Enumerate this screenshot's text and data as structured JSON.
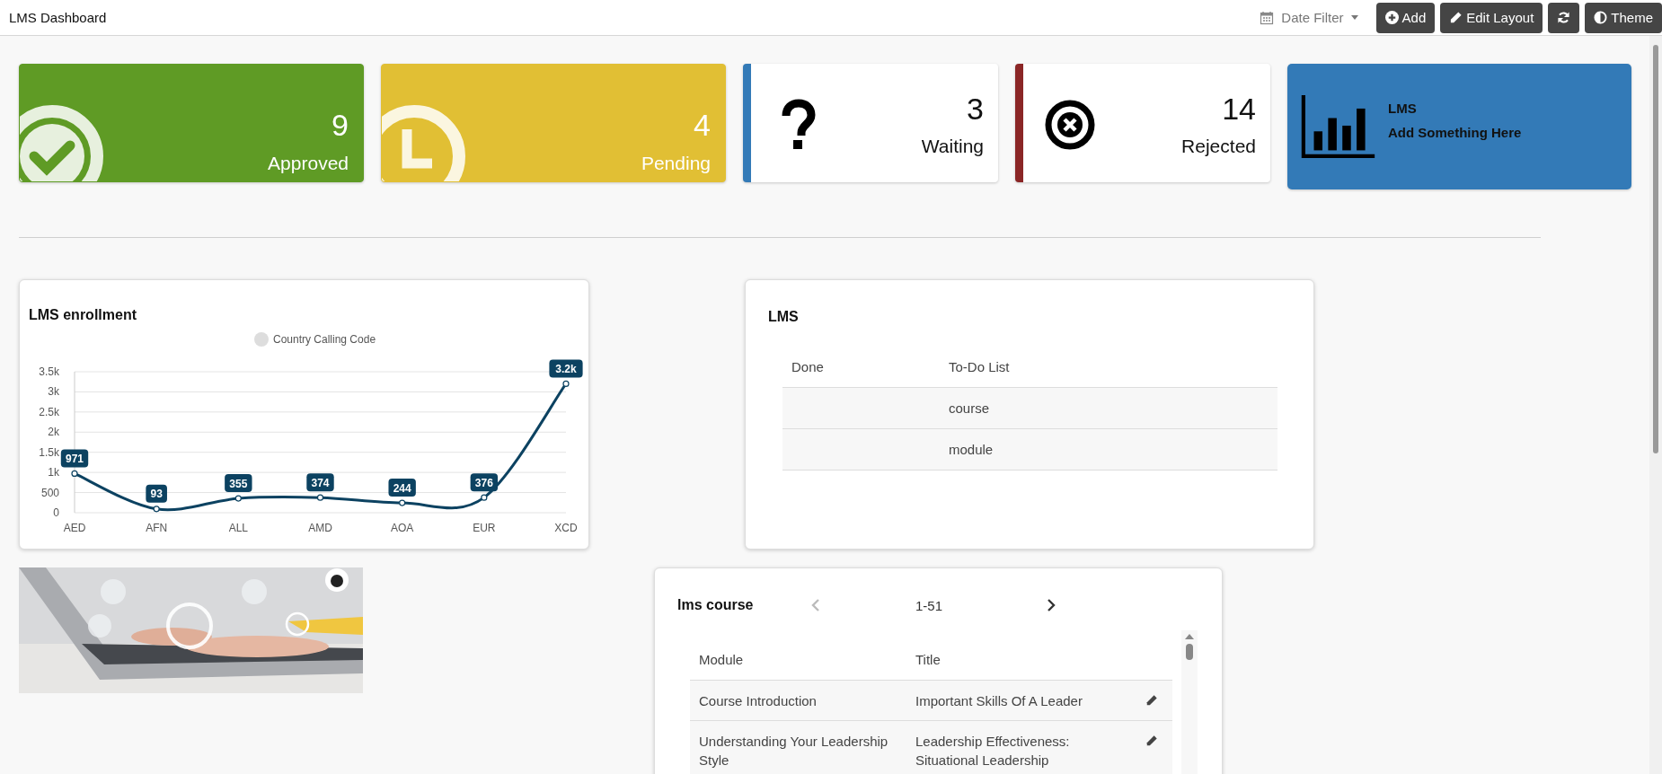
{
  "header": {
    "title": "LMS Dashboard",
    "date_filter": "Date Filter",
    "buttons": [
      {
        "kind": "add",
        "label": "Add"
      },
      {
        "kind": "edit",
        "label": "Edit Layout"
      },
      {
        "kind": "refresh"
      },
      {
        "kind": "theme",
        "label": "Theme"
      }
    ]
  },
  "stat_cards": [
    {
      "kind": "approved",
      "color": "#5f9b25",
      "value": "9",
      "label": "Approved"
    },
    {
      "kind": "pending",
      "color": "#e1bf34",
      "value": "4",
      "label": "Pending"
    },
    {
      "kind": "waiting",
      "color": "#337ab7",
      "value": "3",
      "label": "Waiting"
    },
    {
      "kind": "rejected",
      "color": "#8b2626",
      "value": "14",
      "label": "Rejected"
    }
  ],
  "info_card": {
    "title": "LMS",
    "subtitle": "Add Something Here"
  },
  "enrollment": {
    "title": "LMS enrollment",
    "chart_data": {
      "type": "line",
      "categories": [
        "AED",
        "AFN",
        "ALL",
        "AMD",
        "AOA",
        "EUR",
        "XCD"
      ],
      "series": [
        {
          "name": "Country Calling Code",
          "color": "#0c4261",
          "marker": true,
          "values": [
            971,
            93,
            355,
            374,
            244,
            376,
            3200
          ]
        }
      ],
      "ylim": [
        0,
        3500
      ],
      "grid": true,
      "yticks": [
        {
          "value": 0,
          "label": "0"
        },
        {
          "value": 500,
          "label": "500"
        },
        {
          "value": 1000,
          "label": "1k"
        },
        {
          "value": 1500,
          "label": "1.5k"
        },
        {
          "value": 2000,
          "label": "2k"
        },
        {
          "value": 2500,
          "label": "2.5k"
        },
        {
          "value": 3000,
          "label": "3k"
        },
        {
          "value": 3500,
          "label": "3.5k"
        }
      ],
      "value_labels": [
        "971",
        "93",
        "355",
        "374",
        "244",
        "376",
        "3.2k"
      ]
    }
  },
  "todo": {
    "title": "LMS",
    "columns": [
      "Done",
      "To-Do List"
    ],
    "rows": [
      {
        "todo": "course"
      },
      {
        "todo": "module"
      }
    ]
  },
  "courses": {
    "title": "lms course",
    "pager": {
      "range": "1-51",
      "prev_enabled": false,
      "next_enabled": true
    },
    "columns": [
      "Module",
      "Title"
    ],
    "rows": [
      {
        "module": "Course Introduction",
        "title": "Important Skills Of A Leader"
      },
      {
        "module": "Understanding Your Leadership Style",
        "title": "Leadership Effectiveness: Situational Leadership"
      }
    ]
  }
}
